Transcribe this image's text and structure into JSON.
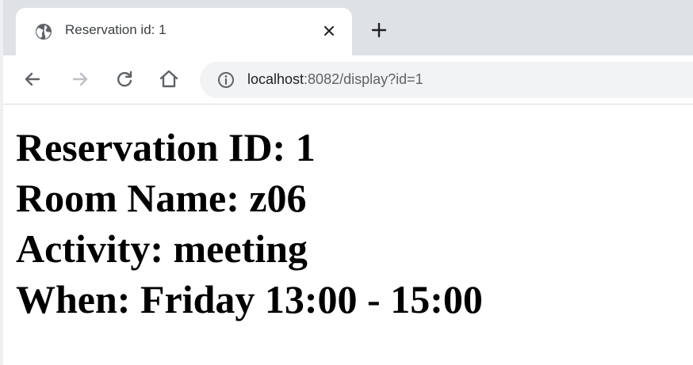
{
  "tab": {
    "title": "Reservation id: 1",
    "favicon_icon": "globe-icon",
    "close_icon": "close-icon"
  },
  "new_tab_icon": "plus-icon",
  "toolbar": {
    "back_icon": "back-arrow-icon",
    "forward_icon": "forward-arrow-icon",
    "reload_icon": "reload-icon",
    "home_icon": "home-icon",
    "site_info_icon": "info-icon"
  },
  "address_bar": {
    "host": "localhost",
    "rest": ":8082/display?id=1"
  },
  "reservation": {
    "id_line": "Reservation ID: 1",
    "room_line": "Room Name: z06",
    "activity_line": "Activity: meeting",
    "when_line": "When: Friday 13:00 - 15:00"
  }
}
